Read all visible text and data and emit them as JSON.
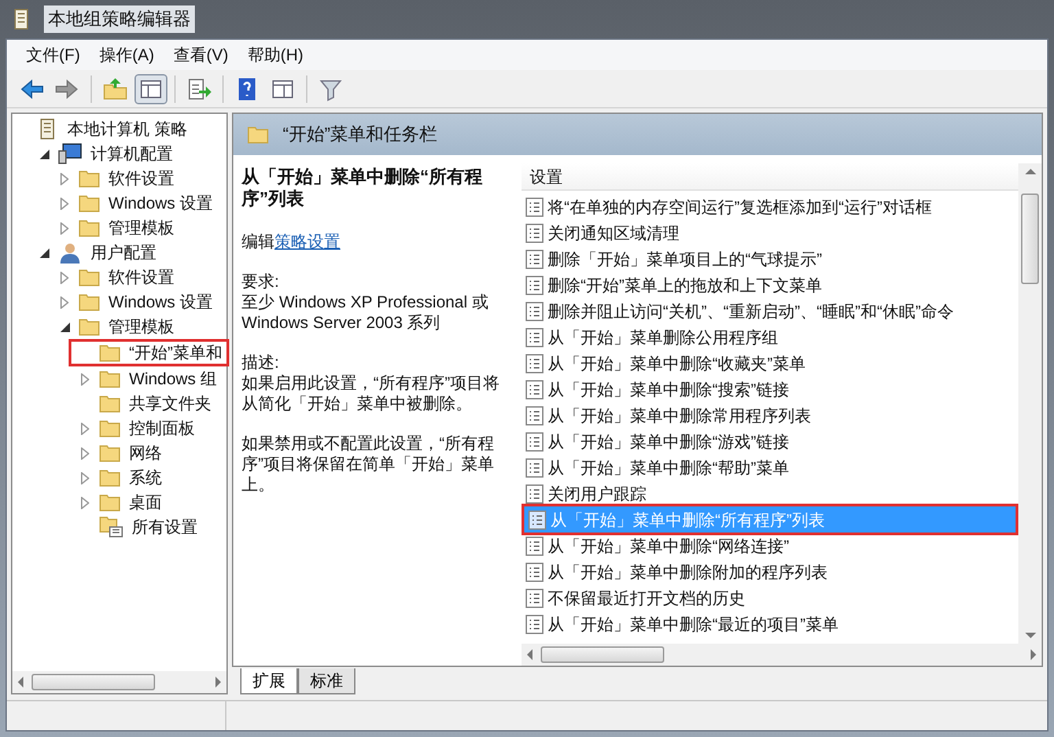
{
  "window": {
    "title": "本地组策略编辑器"
  },
  "menu": [
    "文件(F)",
    "操作(A)",
    "查看(V)",
    "帮助(H)"
  ],
  "toolbar": [
    {
      "kind": "back",
      "pressed": false
    },
    {
      "kind": "forward",
      "pressed": false
    },
    {
      "kind": "up",
      "pressed": false
    },
    {
      "kind": "tree",
      "pressed": true
    },
    {
      "kind": "export",
      "pressed": false
    },
    {
      "kind": "help",
      "pressed": false
    },
    {
      "kind": "pane",
      "pressed": false
    },
    {
      "kind": "filter",
      "pressed": false
    }
  ],
  "tree": [
    {
      "label": "本地计算机 策略",
      "kind": "policy",
      "children": [
        {
          "label": "计算机配置",
          "kind": "computer",
          "expanded": true,
          "children": [
            {
              "label": "软件设置",
              "kind": "folder",
              "expanded": false
            },
            {
              "label": "Windows 设置",
              "kind": "folder",
              "expanded": false
            },
            {
              "label": "管理模板",
              "kind": "folder",
              "expanded": false
            }
          ]
        },
        {
          "label": "用户配置",
          "kind": "user",
          "expanded": true,
          "children": [
            {
              "label": "软件设置",
              "kind": "folder",
              "expanded": false
            },
            {
              "label": "Windows 设置",
              "kind": "folder",
              "expanded": false
            },
            {
              "label": "管理模板",
              "kind": "folder",
              "expanded": true,
              "children": [
                {
                  "label": "“开始”菜单和",
                  "kind": "folder",
                  "highlighted": true
                },
                {
                  "label": "Windows 组",
                  "kind": "folder",
                  "expanded": false
                },
                {
                  "label": "共享文件夹",
                  "kind": "folder"
                },
                {
                  "label": "控制面板",
                  "kind": "folder",
                  "expanded": false
                },
                {
                  "label": "网络",
                  "kind": "folder",
                  "expanded": false
                },
                {
                  "label": "系统",
                  "kind": "folder",
                  "expanded": false
                },
                {
                  "label": "桌面",
                  "kind": "folder",
                  "expanded": false
                },
                {
                  "label": "所有设置",
                  "kind": "settings"
                }
              ]
            }
          ]
        }
      ]
    }
  ],
  "panel": {
    "title": "“开始”菜单和任务栏"
  },
  "description": {
    "title": "从「开始」菜单中删除“所有程序”列表",
    "edit_prefix": "编辑",
    "edit_link": "策略设置",
    "requirements_label": "要求:",
    "requirements": "至少 Windows XP Professional 或 Windows Server 2003 系列",
    "description_label": "描述:",
    "paragraphs": [
      "如果启用此设置，“所有程序”项目将从简化「开始」菜单中被删除。",
      "如果禁用或不配置此设置，“所有程序”项目将保留在简单「开始」菜单上。"
    ]
  },
  "settings": {
    "column": "设置",
    "items": [
      {
        "label": "将“在单独的内存空间运行”复选框添加到“运行”对话框",
        "selected": false,
        "highlighted": false
      },
      {
        "label": "关闭通知区域清理",
        "selected": false,
        "highlighted": false
      },
      {
        "label": "删除「开始」菜单项目上的“气球提示”",
        "selected": false,
        "highlighted": false
      },
      {
        "label": "删除“开始”菜单上的拖放和上下文菜单",
        "selected": false,
        "highlighted": false
      },
      {
        "label": "删除并阻止访问“关机”、“重新启动”、“睡眠”和“休眠”命令",
        "selected": false,
        "highlighted": false
      },
      {
        "label": "从「开始」菜单删除公用程序组",
        "selected": false,
        "highlighted": false
      },
      {
        "label": "从「开始」菜单中删除“收藏夹”菜单",
        "selected": false,
        "highlighted": false
      },
      {
        "label": "从「开始」菜单中删除“搜索”链接",
        "selected": false,
        "highlighted": false
      },
      {
        "label": "从「开始」菜单中删除常用程序列表",
        "selected": false,
        "highlighted": false
      },
      {
        "label": "从「开始」菜单中删除“游戏”链接",
        "selected": false,
        "highlighted": false
      },
      {
        "label": "从「开始」菜单中删除“帮助”菜单",
        "selected": false,
        "highlighted": false
      },
      {
        "label": "关闭用户跟踪",
        "selected": false,
        "highlighted": false
      },
      {
        "label": "从「开始」菜单中删除“所有程序”列表",
        "selected": true,
        "highlighted": true
      },
      {
        "label": "从「开始」菜单中删除“网络连接”",
        "selected": false,
        "highlighted": false
      },
      {
        "label": "从「开始」菜单中删除附加的程序列表",
        "selected": false,
        "highlighted": false
      },
      {
        "label": "不保留最近打开文档的历史",
        "selected": false,
        "highlighted": false
      },
      {
        "label": "从「开始」菜单中删除“最近的项目”菜单",
        "selected": false,
        "highlighted": false
      }
    ]
  },
  "tabs": [
    {
      "label": "扩展",
      "selected": true
    },
    {
      "label": "标准",
      "selected": false
    }
  ]
}
